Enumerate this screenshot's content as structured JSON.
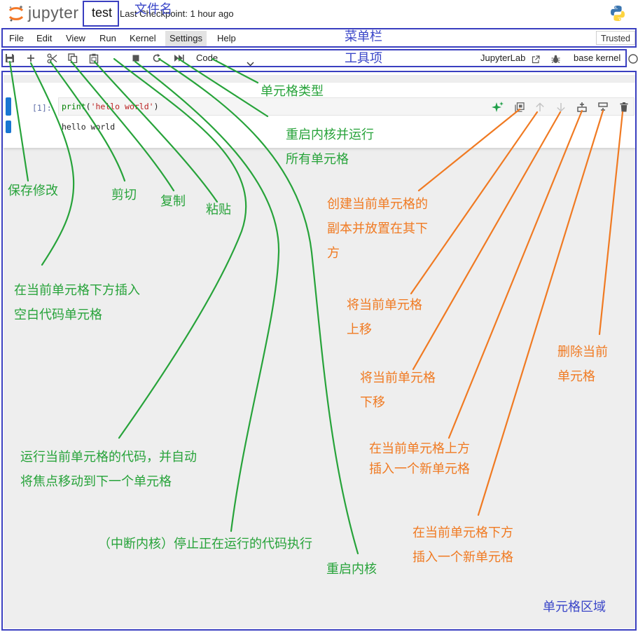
{
  "header": {
    "logo_text": "jupyter",
    "notebook_name": "test",
    "checkpoint": "Last Checkpoint: 1 hour ago"
  },
  "menubar": {
    "items": [
      "File",
      "Edit",
      "View",
      "Run",
      "Kernel",
      "Settings",
      "Help"
    ],
    "trusted": "Trusted"
  },
  "toolbar": {
    "icons": [
      "save-icon",
      "add-icon",
      "cut-icon",
      "copy-icon",
      "paste-icon",
      "stop-icon",
      "restart-icon",
      "run-all-icon"
    ],
    "cell_type": "Code",
    "jupyterlab_link": "JupyterLab",
    "kernel_name": "base kernel"
  },
  "cell": {
    "prompt": "[1]:",
    "code": "print('hello world')",
    "output": "hello world",
    "tools": [
      "sparkle-icon",
      "duplicate-icon",
      "move-up-icon",
      "move-down-icon",
      "insert-above-icon",
      "insert-below-icon",
      "delete-icon"
    ]
  },
  "annotations": {
    "file_name": "文件名",
    "menubar": "菜单栏",
    "toolbar": "工具项",
    "cell_type": "单元格类型",
    "restart_run_all": [
      "重启内核并运行",
      "所有单元格"
    ],
    "save": "保存修改",
    "cut": "剪切",
    "copy": "复制",
    "paste": "粘贴",
    "insert_below_blank": [
      "在当前单元格下方插入",
      "空白代码单元格"
    ],
    "run_cell": [
      "运行当前单元格的代码，并自动",
      "将焦点移动到下一个单元格"
    ],
    "interrupt": "（中断内核）停止正在运行的代码执行",
    "restart": "重启内核",
    "duplicate": [
      "创建当前单元格的",
      "副本并放置在其下",
      "方"
    ],
    "move_up": [
      "将当前单元格",
      "上移"
    ],
    "move_down": [
      "将当前单元格",
      "下移"
    ],
    "delete": [
      "删除当前",
      "单元格"
    ],
    "insert_above": [
      "在当前单元格上方",
      "插入一个新单元格"
    ],
    "insert_below": [
      "在当前单元格下方",
      "插入一个新单元格"
    ],
    "cell_area": "单元格区域"
  },
  "colors": {
    "annotation_blue": "#3a46c8",
    "annotation_green": "#27a33a",
    "annotation_orange": "#f07a22",
    "box_outline": "#3a3fc0",
    "jupyter_orange": "#f37726",
    "collapser_blue": "#1976d2"
  }
}
